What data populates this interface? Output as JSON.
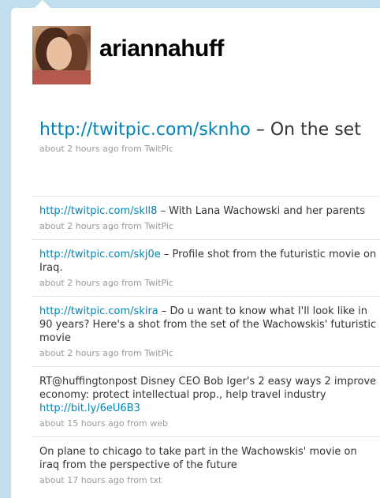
{
  "profile": {
    "username": "ariannahuff",
    "avatar_icon": "profile-photo"
  },
  "featured": {
    "link": "http://twitpic.com/sknho",
    "text": " – On the set",
    "meta": "about 2 hours ago from TwitPic"
  },
  "tweets": [
    {
      "link": "http://twitpic.com/skll8",
      "text": " – With Lana Wachowski and her parents",
      "meta": "about 2 hours ago from TwitPic"
    },
    {
      "link": "http://twitpic.com/skj0e",
      "text": " – Profile shot from the futuristic movie on Iraq.",
      "meta": "about 2 hours ago from TwitPic"
    },
    {
      "link": "http://twitpic.com/skira",
      "text": " – Do u want to know what I'll look like in 90 years? Here's a shot from the set of the Wachowskis' futuristic movie",
      "meta": "about 2 hours ago from TwitPic"
    },
    {
      "text": "RT@huffingtonpost Disney CEO Bob Iger's 2 easy ways 2 improve economy: protect intellectual prop., help travel industry ",
      "link": "http://bit.ly/6eU6B3",
      "meta": "about 15 hours ago from web"
    },
    {
      "text": "On plane to chicago to take part in the Wachowskis' movie on iraq from the perspective of the future",
      "meta": "about 17 hours ago from txt"
    }
  ],
  "colors": {
    "background": "#c0deed",
    "link": "#0084b4",
    "meta": "#999999",
    "text": "#333333"
  }
}
